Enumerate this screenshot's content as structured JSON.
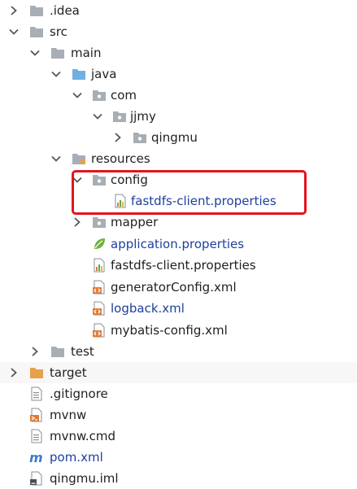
{
  "colors": {
    "folder": "#a8aeb5",
    "source_folder": "#6fb0e3",
    "excluded_folder": "#e8a04a",
    "highlight_border": "#e3141f",
    "blue_label": "#1e3f9e"
  },
  "tree": {
    "items": [
      {
        "label": ".idea",
        "icon": "folder-icon",
        "arrow": "collapsed"
      },
      {
        "label": "src",
        "icon": "folder-icon",
        "arrow": "expanded"
      },
      {
        "label": "main",
        "icon": "folder-icon",
        "arrow": "expanded"
      },
      {
        "label": "java",
        "icon": "source-folder-icon",
        "arrow": "expanded"
      },
      {
        "label": "com",
        "icon": "package-icon",
        "arrow": "expanded"
      },
      {
        "label": "jjmy",
        "icon": "package-icon",
        "arrow": "expanded"
      },
      {
        "label": "qingmu",
        "icon": "package-icon",
        "arrow": "collapsed"
      },
      {
        "label": "resources",
        "icon": "resources-folder-icon",
        "arrow": "expanded"
      },
      {
        "label": "config",
        "icon": "package-icon",
        "arrow": "expanded"
      },
      {
        "label": "fastdfs-client.properties",
        "icon": "properties-file-icon",
        "arrow": "none"
      },
      {
        "label": "mapper",
        "icon": "package-icon",
        "arrow": "collapsed"
      },
      {
        "label": "application.properties",
        "icon": "spring-leaf-icon",
        "arrow": "none"
      },
      {
        "label": "fastdfs-client.properties",
        "icon": "properties-file-icon",
        "arrow": "none"
      },
      {
        "label": "generatorConfig.xml",
        "icon": "xml-file-icon",
        "arrow": "none"
      },
      {
        "label": "logback.xml",
        "icon": "xml-file-icon",
        "arrow": "none"
      },
      {
        "label": "mybatis-config.xml",
        "icon": "xml-file-icon",
        "arrow": "none"
      },
      {
        "label": "test",
        "icon": "folder-icon",
        "arrow": "collapsed"
      },
      {
        "label": "target",
        "icon": "excluded-folder-icon",
        "arrow": "collapsed"
      },
      {
        "label": ".gitignore",
        "icon": "text-file-icon",
        "arrow": "none"
      },
      {
        "label": "mvnw",
        "icon": "script-file-icon",
        "arrow": "none"
      },
      {
        "label": "mvnw.cmd",
        "icon": "text-file-icon",
        "arrow": "none"
      },
      {
        "label": "pom.xml",
        "icon": "maven-m-icon",
        "arrow": "none"
      },
      {
        "label": "qingmu.iml",
        "icon": "iml-file-icon",
        "arrow": "none"
      }
    ]
  }
}
